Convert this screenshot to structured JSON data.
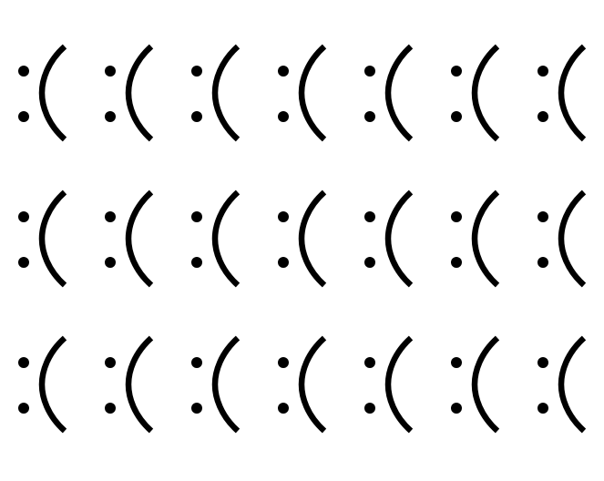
{
  "pattern": {
    "glyph": ":(",
    "rows": 3,
    "columns": 7,
    "ink_color": "#000000",
    "background_color": "#ffffff"
  }
}
